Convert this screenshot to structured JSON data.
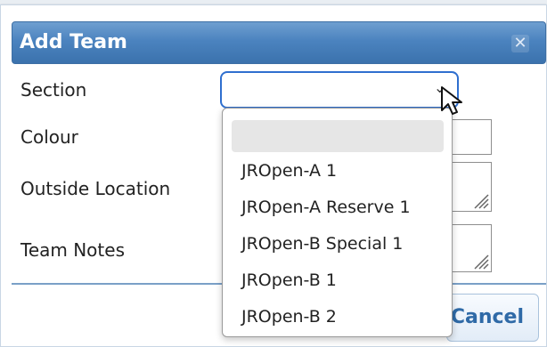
{
  "dialog": {
    "title": "Add Team",
    "close_icon": "close-icon"
  },
  "fields": {
    "section_label": "Section",
    "colour_label": "Colour",
    "outside_location_label": "Outside Location",
    "team_notes_label": "Team Notes",
    "section_value": ""
  },
  "dropdown": {
    "options": [
      "",
      "JROpen-A 1",
      "JROpen-A Reserve 1",
      "JROpen-B Special 1",
      "JROpen-B 1",
      "JROpen-B 2"
    ]
  },
  "buttons": {
    "cancel_label": "Cancel"
  },
  "colors": {
    "titlebar": "#4b83bf",
    "focus_border": "#2f6fcf",
    "cancel_text": "#2f6aa7"
  }
}
